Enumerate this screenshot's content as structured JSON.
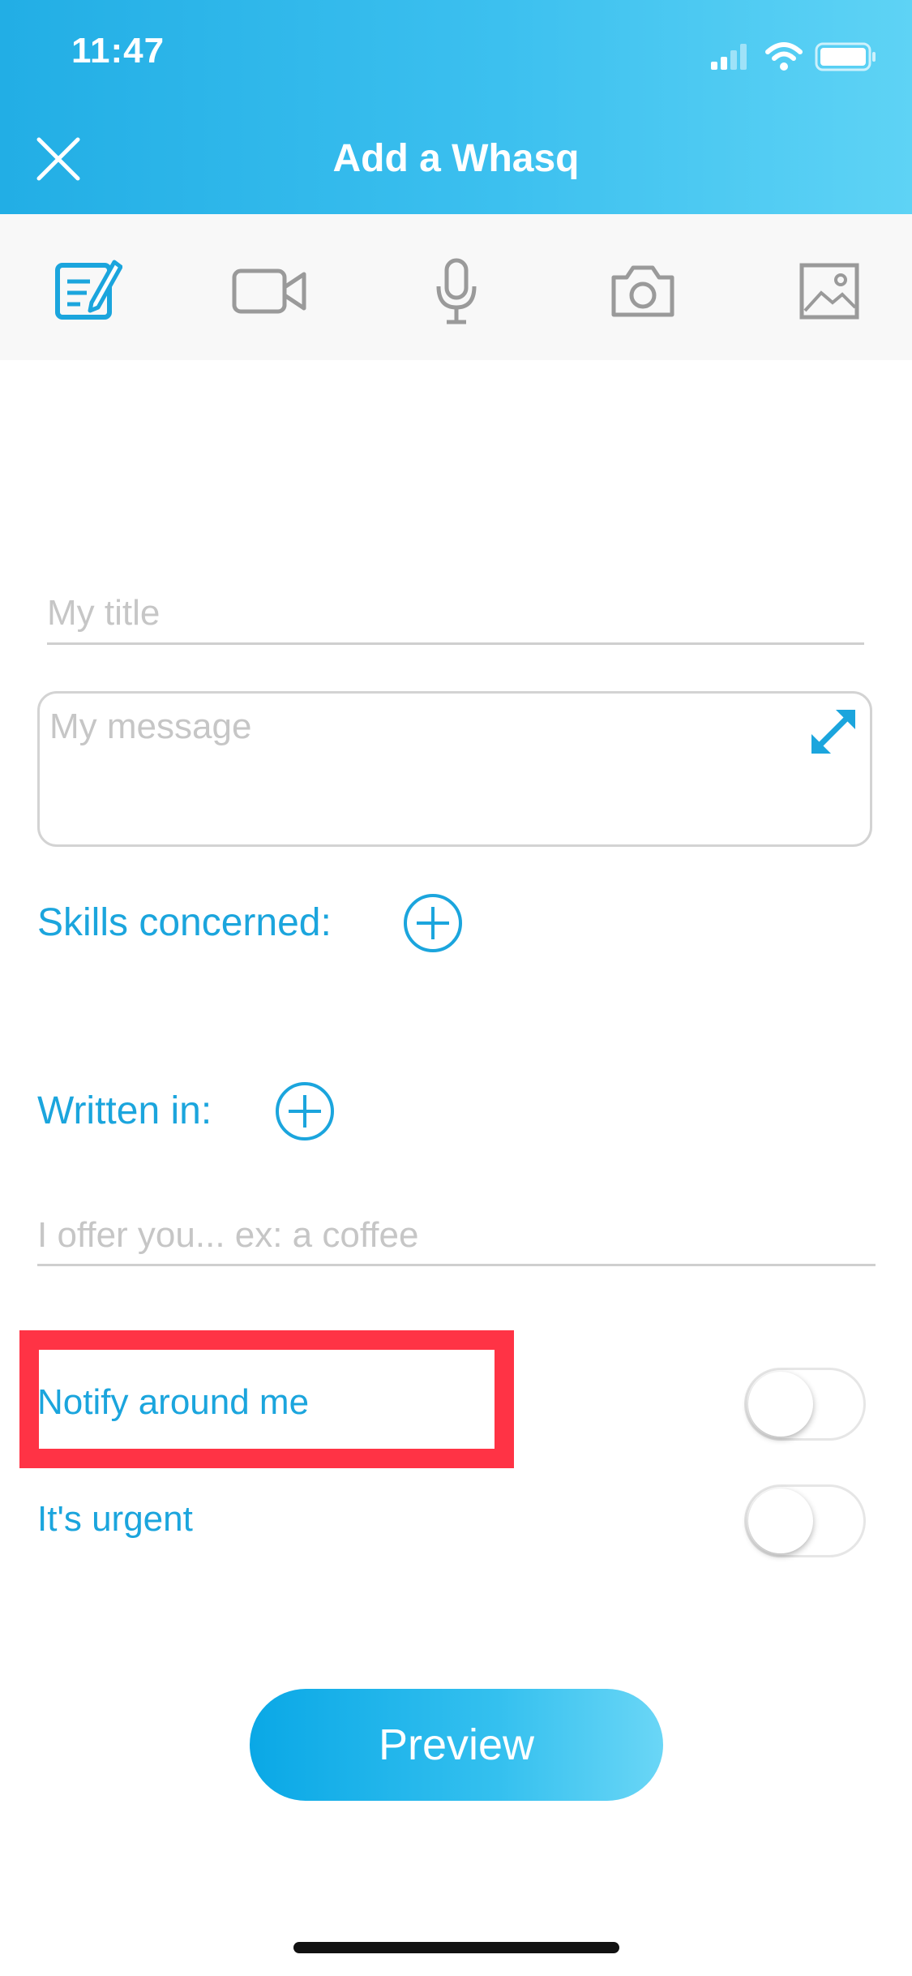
{
  "status_bar": {
    "time": "11:47"
  },
  "header": {
    "title": "Add a Whasq"
  },
  "toolbar": {
    "tools": [
      {
        "icon": "text-edit-icon",
        "active": true
      },
      {
        "icon": "video-icon",
        "active": false
      },
      {
        "icon": "microphone-icon",
        "active": false
      },
      {
        "icon": "camera-icon",
        "active": false
      },
      {
        "icon": "image-icon",
        "active": false
      }
    ]
  },
  "form": {
    "title_placeholder": "My title",
    "title_value": "",
    "message_placeholder": "My message",
    "message_value": "",
    "skills_label": "Skills concerned:",
    "written_in_label": "Written in:",
    "offer_placeholder": "I offer you... ex: a coffee",
    "offer_value": "",
    "notify_label": "Notify around me",
    "notify_on": false,
    "urgent_label": "It's urgent",
    "urgent_on": false,
    "preview_label": "Preview"
  },
  "colors": {
    "accent": "#1ba5dd",
    "highlight": "#ff3345",
    "header_gradient_start": "#22aee5",
    "header_gradient_end": "#5ed3f5"
  }
}
